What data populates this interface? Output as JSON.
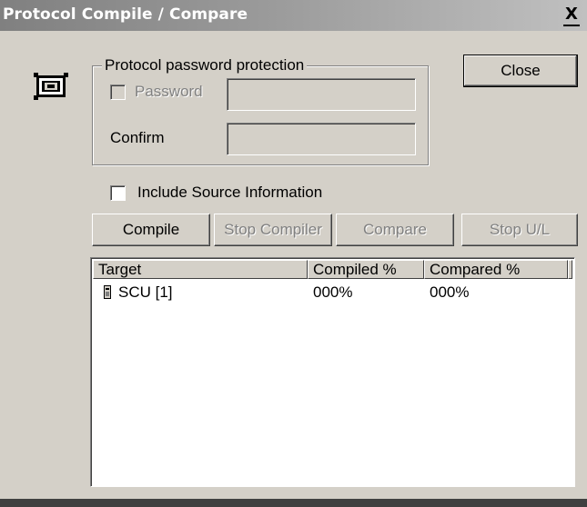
{
  "window": {
    "title": "Protocol Compile / Compare",
    "close_glyph": "X"
  },
  "app_icon": "protocol-compile-icon",
  "password_group": {
    "legend": "Protocol password protection",
    "password_label": "Password",
    "password_checked": false,
    "password_value": "",
    "confirm_label": "Confirm",
    "confirm_value": ""
  },
  "close_button": {
    "label": "Close"
  },
  "include_source": {
    "label": "Include Source Information",
    "checked": false
  },
  "actions": {
    "compile": "Compile",
    "stop_compiler": "Stop Compiler",
    "compare": "Compare",
    "stop_ul": "Stop U/L"
  },
  "list": {
    "columns": [
      "Target",
      "Compiled %",
      "Compared %"
    ],
    "rows": [
      {
        "icon": "device-icon",
        "target": "SCU [1]",
        "compiled": "000%",
        "compared": "000%"
      }
    ]
  }
}
